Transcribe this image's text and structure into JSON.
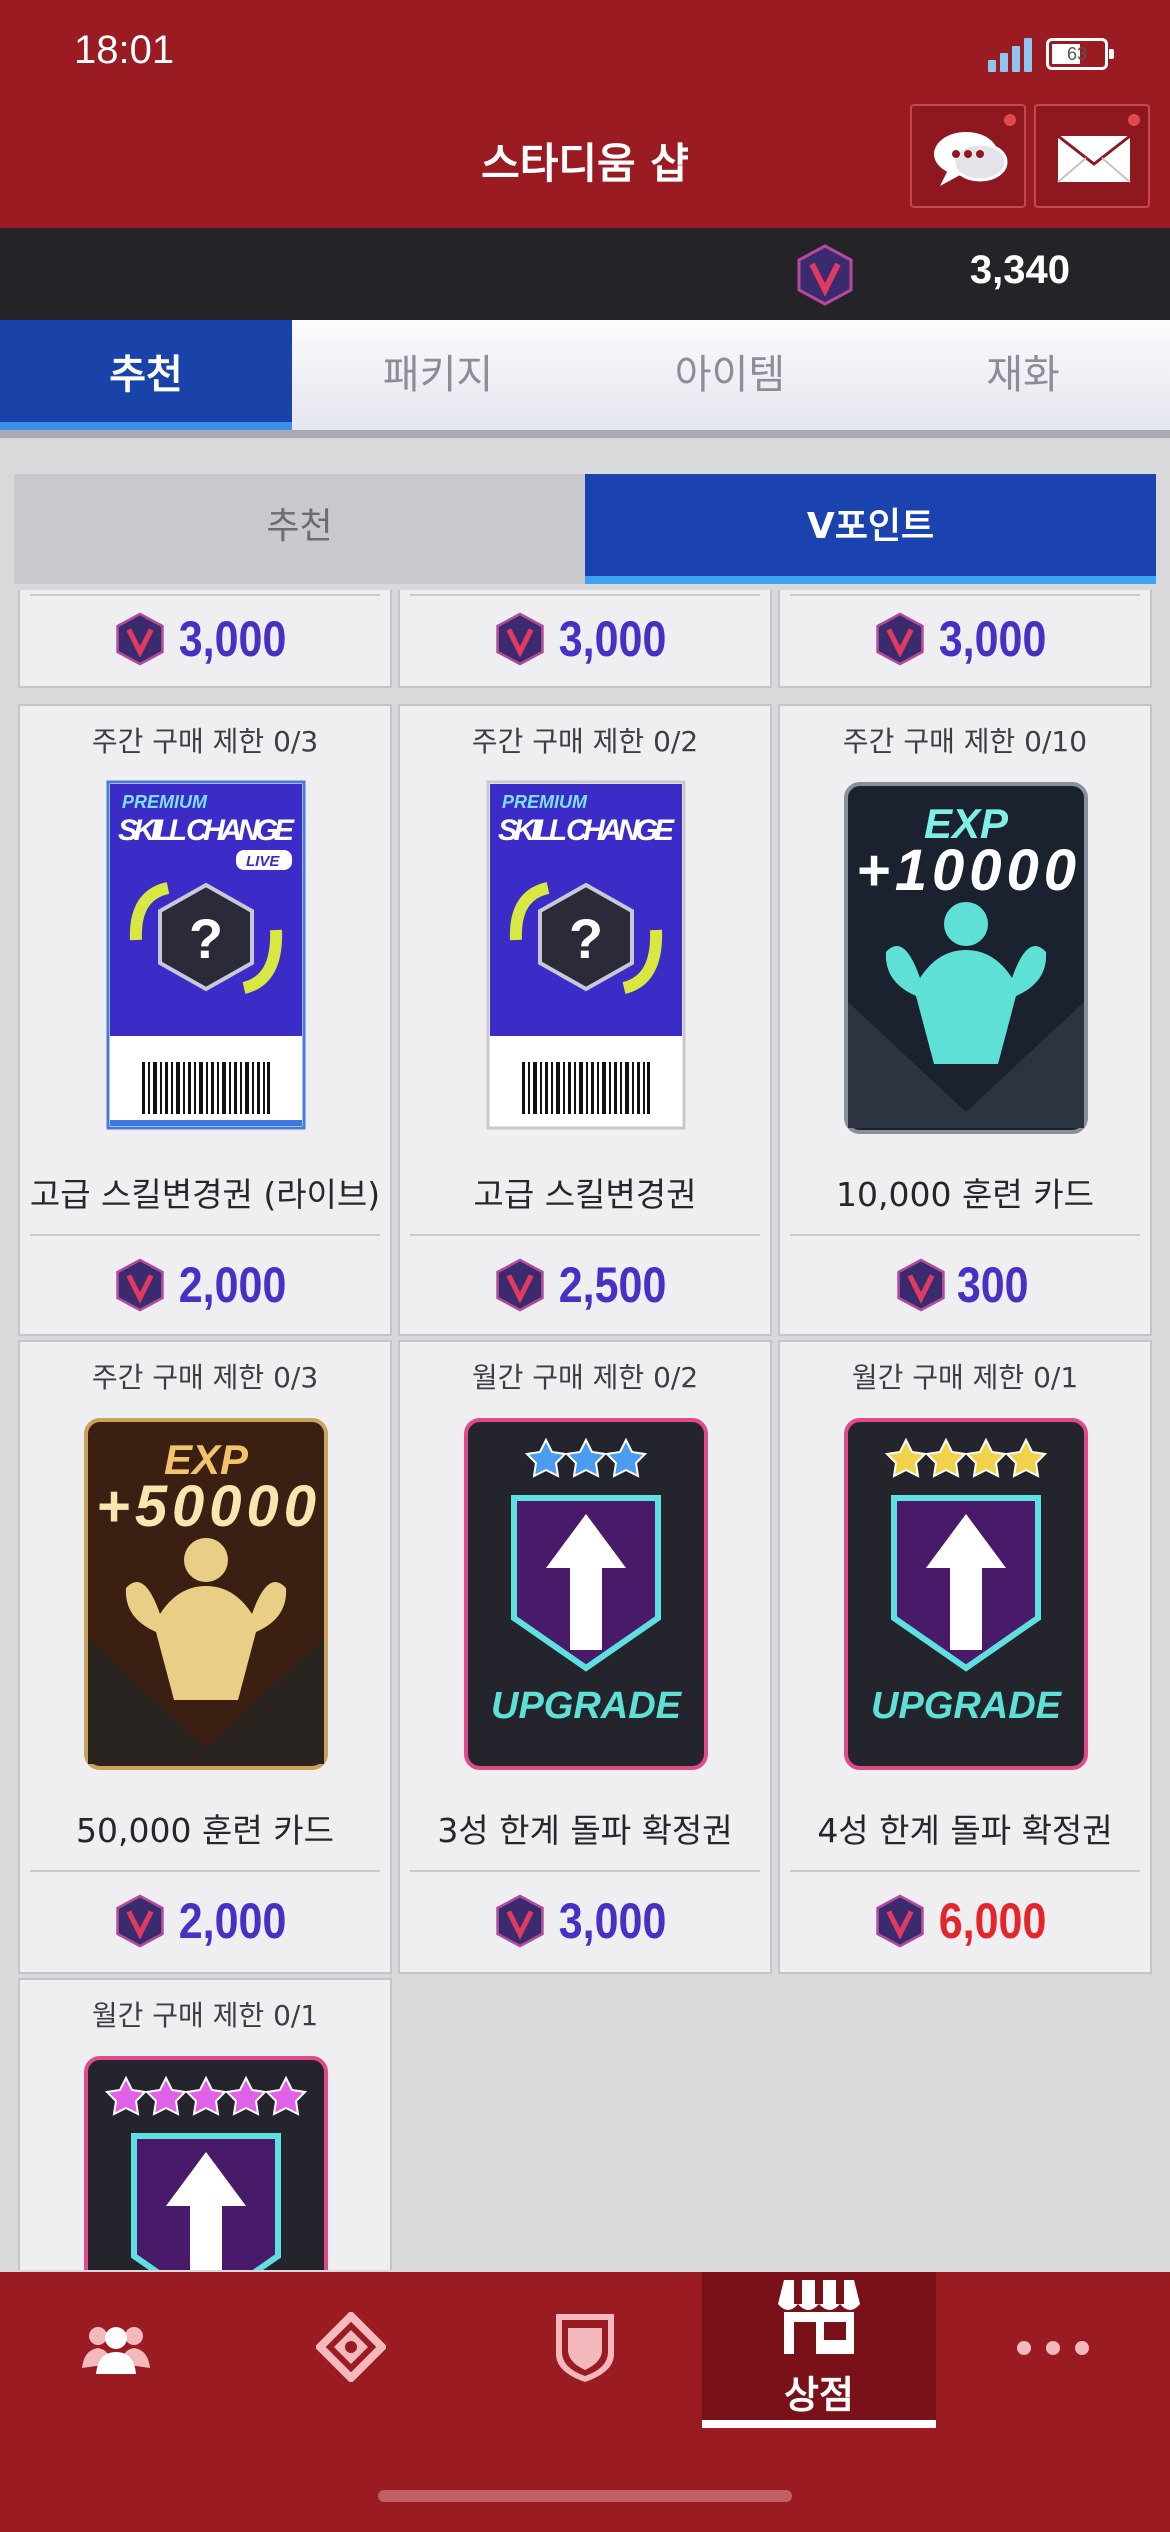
{
  "status_bar": {
    "time": "18:01",
    "battery": "63"
  },
  "header": {
    "title": "스타디움 샵"
  },
  "currency": {
    "amount": "3,340"
  },
  "tabs": [
    {
      "label": "추천",
      "active": true
    },
    {
      "label": "패키지",
      "active": false
    },
    {
      "label": "아이템",
      "active": false
    },
    {
      "label": "재화",
      "active": false
    }
  ],
  "subtabs": [
    {
      "label": "추천",
      "active": false
    },
    {
      "label": "V포인트",
      "active": true
    }
  ],
  "partial_row_prices": [
    "3,000",
    "3,000",
    "3,000"
  ],
  "items": [
    {
      "limit": "주간 구매 제한 0/3",
      "name": "고급 스킬변경권 (라이브)",
      "price": "2,000",
      "art": "skill-change-live",
      "art_text": [
        "PREMIUM",
        "SKILL CHANGE",
        "LIVE"
      ]
    },
    {
      "limit": "주간 구매 제한 0/2",
      "name": "고급 스킬변경권",
      "price": "2,500",
      "art": "skill-change",
      "art_text": [
        "PREMIUM",
        "SKILL CHANGE"
      ]
    },
    {
      "limit": "주간 구매 제한 0/10",
      "name": "10,000 훈련 카드",
      "price": "300",
      "art": "exp-10000",
      "art_text": [
        "EXP",
        "+10000"
      ]
    },
    {
      "limit": "주간 구매 제한 0/3",
      "name": "50,000 훈련 카드",
      "price": "2,000",
      "art": "exp-50000",
      "art_text": [
        "EXP",
        "+50000"
      ]
    },
    {
      "limit": "월간 구매 제한 0/2",
      "name": "3성 한계 돌파 확정권",
      "price": "3,000",
      "art": "upgrade-3star",
      "art_text": [
        "UPGRADE"
      ]
    },
    {
      "limit": "월간 구매 제한 0/1",
      "name": "4성 한계 돌파 확정권",
      "price": "6,000",
      "price_color": "#e2262b",
      "art": "upgrade-4star",
      "art_text": [
        "UPGRADE"
      ]
    },
    {
      "limit": "월간 구매 제한 0/1",
      "name": "",
      "price": "",
      "art": "upgrade-5star",
      "art_text": []
    }
  ],
  "bottom_nav": [
    {
      "icon": "team-icon",
      "label": ""
    },
    {
      "icon": "stadium-icon",
      "label": ""
    },
    {
      "icon": "shield-icon",
      "label": ""
    },
    {
      "icon": "shop-icon",
      "label": "상점",
      "active": true
    },
    {
      "icon": "more-icon",
      "label": ""
    }
  ],
  "colors": {
    "brand_red": "#9a1b22",
    "tab_blue": "#1943a8",
    "price_purple": "#4a2fc4",
    "price_red": "#e2262b"
  }
}
